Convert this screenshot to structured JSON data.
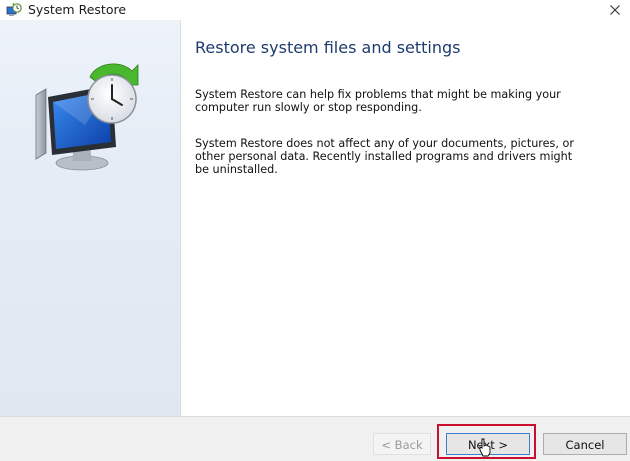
{
  "window": {
    "title": "System Restore",
    "title_icon": "system-restore-icon",
    "close_icon": "close-icon"
  },
  "content": {
    "heading": "Restore system files and settings",
    "paragraph1": "System Restore can help fix problems that might be making your computer run slowly or stop responding.",
    "paragraph2": "System Restore does not affect any of your documents, pictures, or other personal data. Recently installed programs and drivers might be uninstalled."
  },
  "buttons": {
    "back": "< Back",
    "next": "Next >",
    "cancel": "Cancel"
  },
  "colors": {
    "heading": "#1f3b6e",
    "highlight": "#c8102e",
    "focus_border": "#3c7fd0"
  }
}
